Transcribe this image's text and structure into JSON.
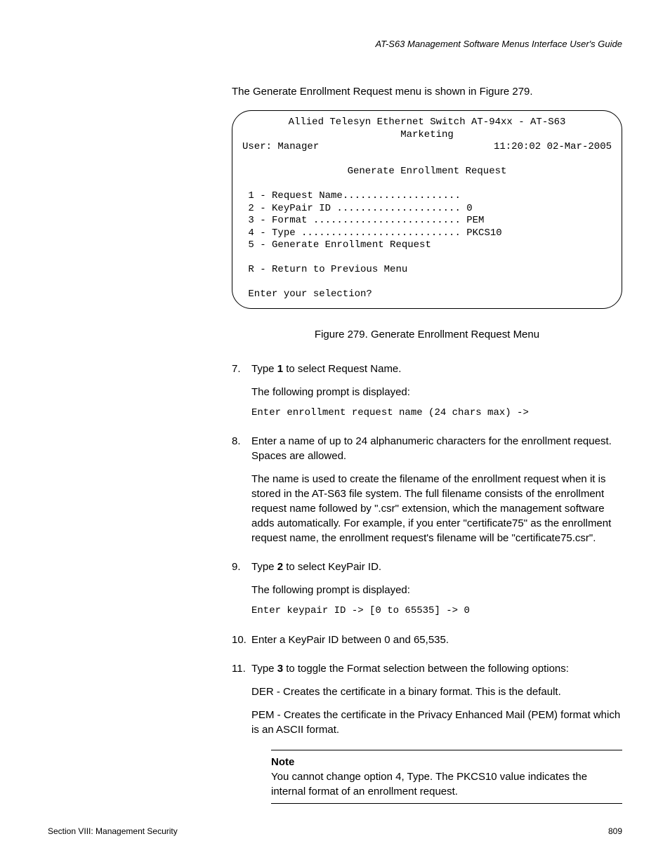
{
  "header": "AT-S63 Management Software Menus Interface User's Guide",
  "intro": "The Generate Enrollment Request menu is shown in Figure 279.",
  "terminal": {
    "title": "Allied Telesyn Ethernet Switch AT-94xx - AT-S63",
    "subtitle": "Marketing",
    "user_line_left": "User: Manager",
    "user_line_right": "11:20:02 02-Mar-2005",
    "menu_title": "Generate Enrollment Request",
    "items": [
      "1 - Request Name....................",
      "2 - KeyPair ID ..................... 0",
      "3 - Format ......................... PEM",
      "4 - Type ........................... PKCS10",
      "5 - Generate Enrollment Request"
    ],
    "return_line": "R - Return to Previous Menu",
    "prompt": "Enter your selection?"
  },
  "figure_caption": "Figure 279. Generate Enrollment Request Menu",
  "steps": {
    "s7": {
      "num": "7.",
      "line1a": "Type ",
      "line1b": "1",
      "line1c": " to select Request Name.",
      "para1": "The following prompt is displayed:",
      "mono": "Enter enrollment request name (24 chars max) ->"
    },
    "s8": {
      "num": "8.",
      "line1": "Enter a name of up to 24 alphanumeric characters for the enrollment request. Spaces are allowed.",
      "para1": "The name is used to create the filename of the enrollment request when it is stored in the AT-S63 file system. The full filename consists of the enrollment request name followed by \".csr\" extension, which the management software adds automatically. For example, if you enter \"certificate75\" as the enrollment request name, the enrollment request's filename will be \"certificate75.csr\"."
    },
    "s9": {
      "num": "9.",
      "line1a": "Type ",
      "line1b": "2",
      "line1c": " to select KeyPair ID.",
      "para1": "The following prompt is displayed:",
      "mono": "Enter keypair ID -> [0 to 65535] -> 0"
    },
    "s10": {
      "num": "10.",
      "line1": "Enter a KeyPair ID between 0 and 65,535."
    },
    "s11": {
      "num": "11.",
      "line1a": "Type ",
      "line1b": "3",
      "line1c": " to toggle the Format selection between the following options:",
      "para1": "DER - Creates the certificate in a binary format. This is the default.",
      "para2": "PEM - Creates the certificate in the Privacy Enhanced Mail (PEM) format which is an ASCII format."
    }
  },
  "note": {
    "title": "Note",
    "body": "You cannot change option 4, Type. The PKCS10 value indicates the internal format of an enrollment request."
  },
  "footer": {
    "left": "Section VIII: Management Security",
    "right": "809"
  }
}
